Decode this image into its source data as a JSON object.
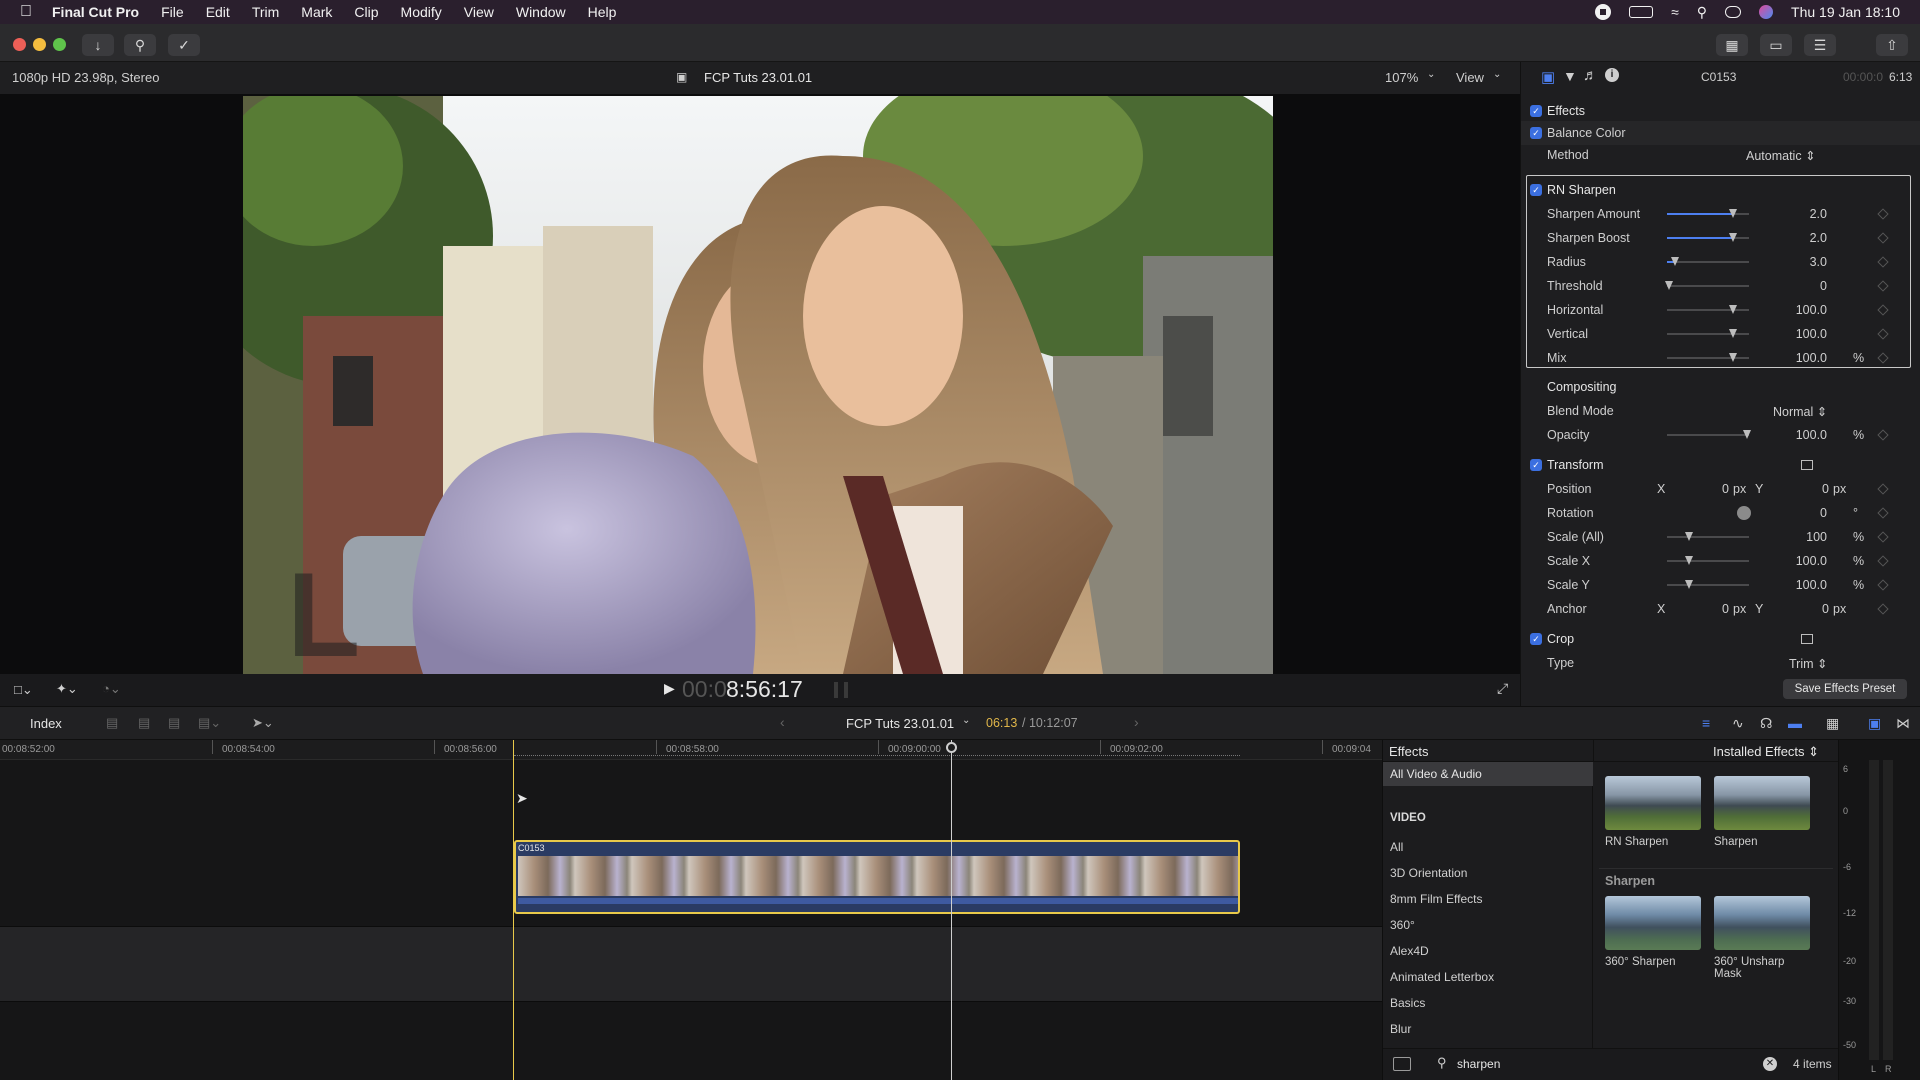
{
  "menubar": {
    "app": "Final Cut Pro",
    "items": [
      "File",
      "Edit",
      "Trim",
      "Mark",
      "Clip",
      "Modify",
      "View",
      "Window",
      "Help"
    ],
    "datetime": "Thu 19 Jan  18:10"
  },
  "viewer": {
    "format": "1080p HD 23.98p, Stereo",
    "project": "FCP Tuts 23.01.01",
    "zoom": "107%",
    "view": "View",
    "timecode_dim": "00:0",
    "timecode": "8:56:17"
  },
  "inspector": {
    "clip": "C0153",
    "duration_dim": "00:00:0",
    "duration": "6:13",
    "effects_label": "Effects",
    "balance_color": "Balance Color",
    "method_label": "Method",
    "method_value": "Automatic",
    "rn_sharpen": "RN Sharpen",
    "params": [
      {
        "label": "Sharpen Amount",
        "value": "2.0",
        "unit": "",
        "level": 0.8
      },
      {
        "label": "Sharpen Boost",
        "value": "2.0",
        "unit": "",
        "level": 0.8
      },
      {
        "label": "Radius",
        "value": "3.0",
        "unit": "",
        "level": 0.1
      },
      {
        "label": "Threshold",
        "value": "0",
        "unit": "",
        "level": 0.02
      },
      {
        "label": "Horizontal",
        "value": "100.0",
        "unit": "",
        "level": 0.8
      },
      {
        "label": "Vertical",
        "value": "100.0",
        "unit": "",
        "level": 0.8
      },
      {
        "label": "Mix",
        "value": "100.0",
        "unit": "%",
        "level": 0.8
      }
    ],
    "compositing": "Compositing",
    "blend_label": "Blend Mode",
    "blend_value": "Normal",
    "opacity_label": "Opacity",
    "opacity_value": "100.0",
    "opacity_unit": "%",
    "transform": "Transform",
    "position_label": "Position",
    "x": "X",
    "y": "Y",
    "pos_x": "0",
    "pos_y": "0",
    "px": "px",
    "rotation_label": "Rotation",
    "rotation_value": "0",
    "deg": "°",
    "scale_all_label": "Scale (All)",
    "scale_all_value": "100",
    "scale_x_label": "Scale X",
    "scale_x_value": "100.0",
    "scale_y_label": "Scale Y",
    "scale_y_value": "100.0",
    "pct": "%",
    "anchor_label": "Anchor",
    "anchor_x": "0",
    "anchor_y": "0",
    "crop": "Crop",
    "type_label": "Type",
    "type_value": "Trim",
    "save_preset": "Save Effects Preset"
  },
  "timeline": {
    "index": "Index",
    "project": "FCP Tuts 23.01.01",
    "position": "06:13",
    "total": "/ 10:12:07",
    "ruler": [
      "00:08:52:00",
      "00:08:54:00",
      "00:08:56:00",
      "00:08:58:00",
      "00:09:00:00",
      "00:09:02:00",
      "00:09:04"
    ],
    "clip_name": "C0153"
  },
  "effects_browser": {
    "title": "Effects",
    "installed": "Installed Effects",
    "all_av": "All Video & Audio",
    "video_header": "VIDEO",
    "categories": [
      "All",
      "3D Orientation",
      "8mm Film Effects",
      "360°",
      "Alex4D",
      "Animated Letterbox",
      "Basics",
      "Blur"
    ],
    "top_items": [
      "RN Sharpen",
      "Sharpen"
    ],
    "section": "Sharpen",
    "bottom_items": [
      "360° Sharpen",
      "360° Unsharp Mask"
    ],
    "search_value": "sharpen",
    "count": "4 items"
  },
  "meters": {
    "scale": [
      "6",
      "0",
      "-6",
      "-12",
      "-20",
      "-30",
      "-50"
    ],
    "channels": [
      "L",
      "R"
    ]
  },
  "colors": {
    "accent": "#3b6fe0",
    "selection": "#e8c94a",
    "timecode_yellow": "#e0b64a"
  }
}
